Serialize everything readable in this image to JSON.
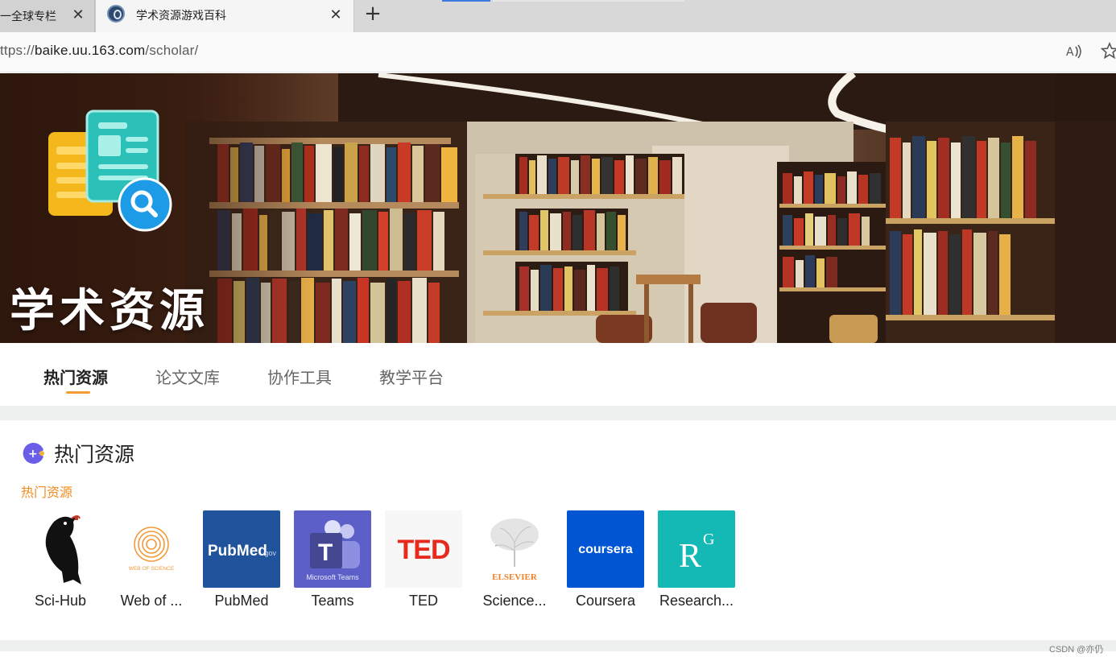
{
  "browser": {
    "tabs": [
      {
        "title": "一全球专栏",
        "active": false
      },
      {
        "title": "学术资源游戏百科",
        "active": true
      }
    ],
    "close_glyph": "✕",
    "new_tab_glyph": "+",
    "url_prefix": "ttps://",
    "url_host": "baike.uu.163.com",
    "url_path": "/scholar/",
    "toolbar_icons": [
      "read-aloud-icon",
      "favorite-star-icon"
    ]
  },
  "hero": {
    "title": "学术资源"
  },
  "category_tabs": [
    {
      "label": "热门资源",
      "active": true
    },
    {
      "label": "论文文库",
      "active": false
    },
    {
      "label": "协作工具",
      "active": false
    },
    {
      "label": "教学平台",
      "active": false
    }
  ],
  "section": {
    "title": "热门资源",
    "subheading": "热门资源"
  },
  "resources": [
    {
      "label": "Sci-Hub",
      "icon": "raven-icon"
    },
    {
      "label": "Web of ...",
      "icon": "web-of-science-icon",
      "tile_text": "WEB OF SCIENCE"
    },
    {
      "label": "PubMed",
      "icon": "pubmed-icon",
      "tile_text": "PubMed",
      "tile_suffix": ".gov"
    },
    {
      "label": "Teams",
      "icon": "teams-icon",
      "tile_text": "Microsoft Teams"
    },
    {
      "label": "TED",
      "icon": "ted-icon",
      "tile_text": "TED"
    },
    {
      "label": "Science...",
      "icon": "sciencedirect-icon",
      "tile_text": "ELSEVIER"
    },
    {
      "label": "Coursera",
      "icon": "coursera-icon",
      "tile_text": "coursera"
    },
    {
      "label": "Research...",
      "icon": "researchgate-icon",
      "tile_text": "R",
      "tile_sup": "G"
    }
  ],
  "colors": {
    "accent_orange": "#f39c32",
    "subheading_orange": "#f28a1c",
    "pubmed_blue": "#20539c",
    "teams_purple": "#5b5fc7",
    "ted_red": "#e62b1e",
    "coursera_blue": "#0056d2",
    "researchgate_teal": "#14b8b4"
  },
  "watermark": "CSDN @亦仍"
}
